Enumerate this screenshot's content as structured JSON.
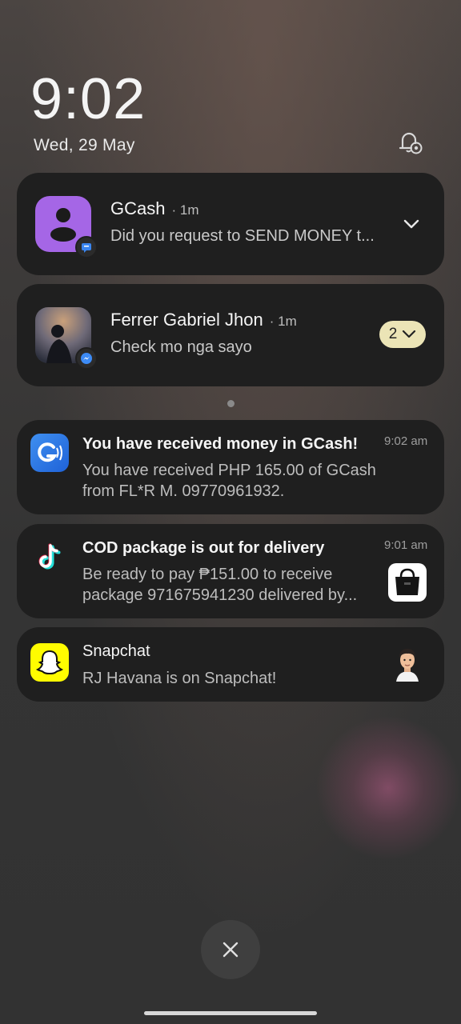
{
  "lockscreen": {
    "time": "9:02",
    "date": "Wed, 29 May"
  },
  "notifications": [
    {
      "app": "GCash",
      "meta": "· 1m",
      "text": "Did you request to SEND MONEY t...",
      "badge_icon": "message-icon",
      "accent": "#a768e8"
    },
    {
      "app": "Ferrer Gabriel Jhon",
      "meta": "· 1m",
      "text": "Check mo nga sayo",
      "count": "2",
      "badge_icon": "messenger-icon"
    },
    {
      "title": "You have received money in GCash!",
      "time": "9:02 am",
      "body_line1": "You have received PHP 165.00 of GCash",
      "body_line2": "from FL*R M. 09770961932.",
      "icon": "gcash-icon",
      "accent": "#2f7be8"
    },
    {
      "title": "COD package is out for delivery",
      "time": "9:01 am",
      "body_line1": "Be ready to pay ₱151.00 to receive",
      "body_line2": "package 971675941230 delivered by...",
      "icon": "tiktok-icon"
    },
    {
      "title": "Snapchat",
      "body": "RJ Havana is on Snapchat!",
      "icon": "snapchat-icon",
      "accent": "#fffc00"
    }
  ]
}
